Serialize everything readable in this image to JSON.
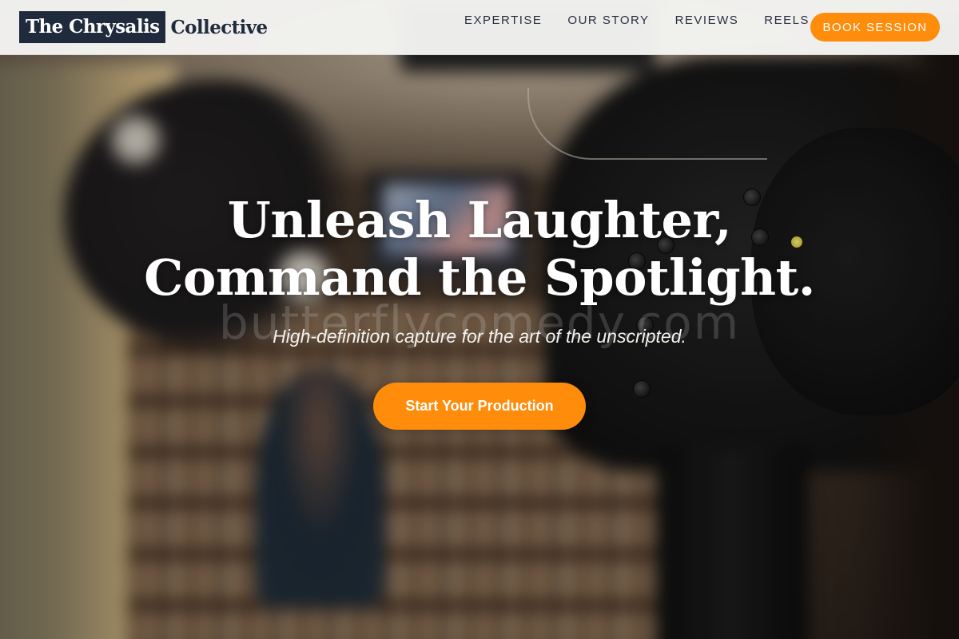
{
  "brand": {
    "logo_box": "The Chrysalis",
    "logo_rest": "Collective",
    "color_navy": "#1f2a3c"
  },
  "nav": {
    "links": [
      "EXPERTISE",
      "OUR STORY",
      "REVIEWS",
      "REELS"
    ],
    "book_label": "BOOK SESSION"
  },
  "hero": {
    "title_line1": "Unleash Laughter,",
    "title_line2": "Command the Spotlight.",
    "watermark": "butterflycomedy.com",
    "subtitle": "High-definition capture for the art of the unscripted.",
    "cta_label": "Start Your Production"
  },
  "colors": {
    "accent": "#ff8c0a",
    "navbar_bg": "#f4f4f2",
    "text_light": "#ffffff"
  }
}
